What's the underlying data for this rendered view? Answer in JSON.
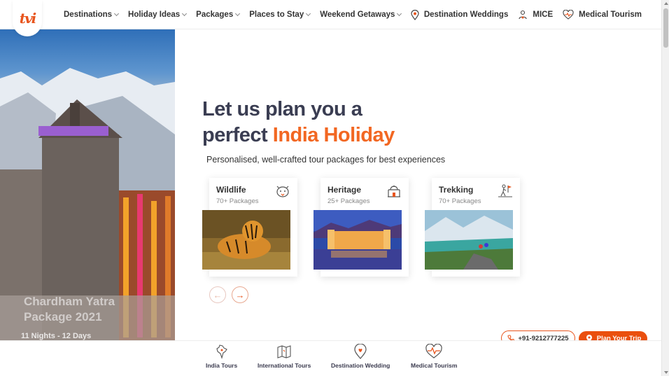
{
  "logo": {
    "text": "tvi"
  },
  "nav": {
    "items": [
      "Destinations",
      "Holiday Ideas",
      "Packages",
      "Places to Stay",
      "Weekend Getaways"
    ],
    "right": [
      "Destination Weddings",
      "MICE",
      "Medical Tourism"
    ]
  },
  "hero": {
    "caption_line1": "Chardham Yatra",
    "caption_line2": "Package 2021",
    "duration": "11 Nights - 12 Days"
  },
  "headline": {
    "line1": "Let us plan you a",
    "line2_prefix": "perfect ",
    "line2_accent": "India Holiday",
    "subline": "Personalised, well-crafted tour packages for best experiences"
  },
  "cards": [
    {
      "title": "Wildlife",
      "count": "70+ Packages",
      "icon": "tiger-icon"
    },
    {
      "title": "Heritage",
      "count": "25+ Packages",
      "icon": "palace-icon"
    },
    {
      "title": "Trekking",
      "count": "70+ Packages",
      "icon": "trekker-icon"
    }
  ],
  "cta": {
    "phone": "+91-9212777225",
    "plan": "Plan Your Trip"
  },
  "bottom_nav": [
    "India Tours",
    "International Tours",
    "Destination Wedding",
    "Medical Tourism"
  ],
  "colors": {
    "accent": "#f26722",
    "cta": "#ea4f0e",
    "text": "#3a3d52"
  }
}
